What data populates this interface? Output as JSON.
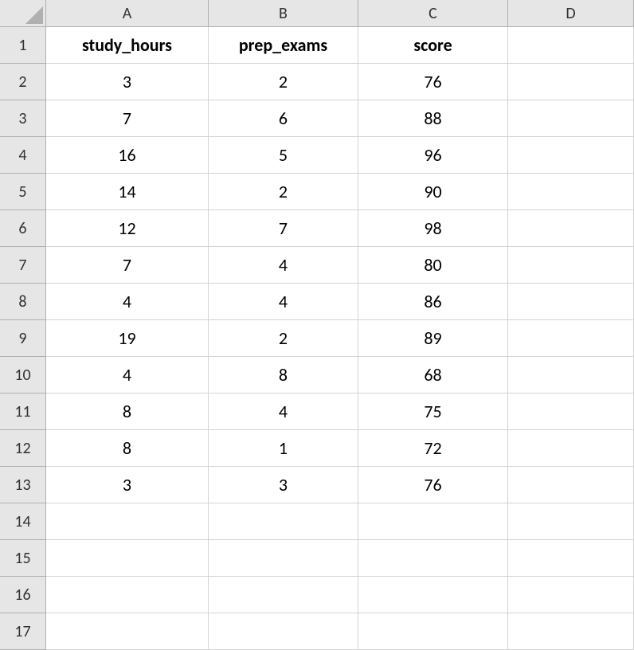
{
  "columns": [
    "A",
    "B",
    "C",
    "D"
  ],
  "rowNumbers": [
    "1",
    "2",
    "3",
    "4",
    "5",
    "6",
    "7",
    "8",
    "9",
    "10",
    "11",
    "12",
    "13",
    "14",
    "15",
    "16",
    "17"
  ],
  "headers": {
    "A": "study_hours",
    "B": "prep_exams",
    "C": "score"
  },
  "data": [
    {
      "A": "3",
      "B": "2",
      "C": "76"
    },
    {
      "A": "7",
      "B": "6",
      "C": "88"
    },
    {
      "A": "16",
      "B": "5",
      "C": "96"
    },
    {
      "A": "14",
      "B": "2",
      "C": "90"
    },
    {
      "A": "12",
      "B": "7",
      "C": "98"
    },
    {
      "A": "7",
      "B": "4",
      "C": "80"
    },
    {
      "A": "4",
      "B": "4",
      "C": "86"
    },
    {
      "A": "19",
      "B": "2",
      "C": "89"
    },
    {
      "A": "4",
      "B": "8",
      "C": "68"
    },
    {
      "A": "8",
      "B": "4",
      "C": "75"
    },
    {
      "A": "8",
      "B": "1",
      "C": "72"
    },
    {
      "A": "3",
      "B": "3",
      "C": "76"
    }
  ]
}
